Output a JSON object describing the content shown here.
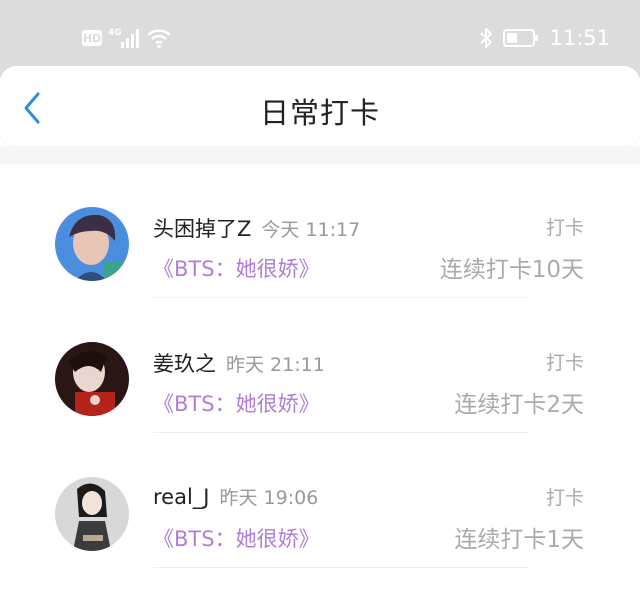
{
  "status_bar": {
    "hd_badge": "HD",
    "network": "4G",
    "time": "11:51"
  },
  "header": {
    "title": "日常打卡"
  },
  "entries": [
    {
      "name": "头困掉了Z",
      "time": "今天 11:17",
      "book": "《BTS：她很娇》",
      "tag": "打卡",
      "streak": "连续打卡10天"
    },
    {
      "name": "姜玖之",
      "time": "昨天 21:11",
      "book": "《BTS：她很娇》",
      "tag": "打卡",
      "streak": "连续打卡2天"
    },
    {
      "name": "real_J",
      "time": "昨天 19:06",
      "book": "《BTS：她很娇》",
      "tag": "打卡",
      "streak": "连续打卡1天"
    }
  ],
  "colors": {
    "accent": "#2b8de3",
    "book_link": "#b07ed6",
    "status_bar_bg": "#dcdcdc",
    "muted_text": "#aaaaaa"
  }
}
